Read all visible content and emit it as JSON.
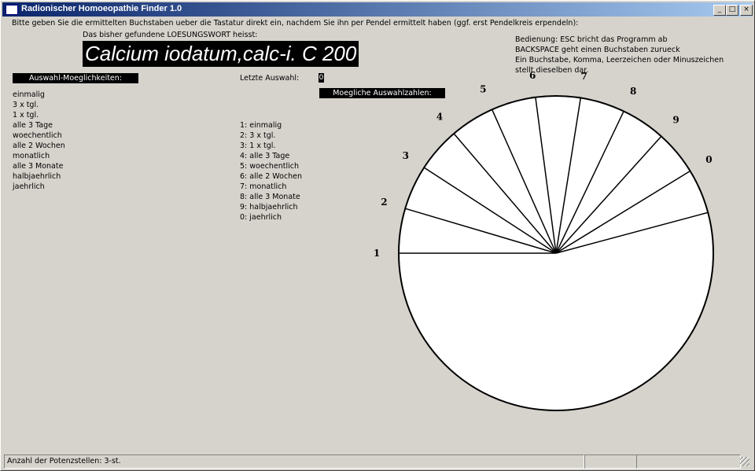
{
  "window": {
    "title": "Radionischer Homoeopathie Finder 1.0"
  },
  "titlebar_buttons": {
    "minimize": "_",
    "maximize": "□",
    "close": "×"
  },
  "instruction": "Bitte geben Sie die ermittelten Buchstaben ueber die Tastatur direkt ein, nachdem Sie ihn per Pendel ermittelt haben (ggf. erst Pendelkreis erpendeln):",
  "found_word_label": "Das bisher gefundene LOESUNGSWORT heisst:",
  "found_word": "Calcium iodatum,calc-i. C  200",
  "help": {
    "line1": "Bedienung: ESC bricht das Programm ab",
    "line2": "BACKSPACE geht einen Buchstaben zurueck",
    "line3": "Ein Buchstabe, Komma, Leerzeichen oder Minuszeichen",
    "line4": "stellt dieselben dar."
  },
  "options_header": "Auswahl-Moeglichkeiten:",
  "options": [
    "einmalig",
    "3 x tgl.",
    "1 x tgl.",
    "alle 3 Tage",
    "woechentlich",
    "alle 2 Wochen",
    "monatlich",
    "alle 3 Monate",
    "halbjaehrlich",
    "jaehrlich"
  ],
  "last_selection_label": "Letzte Auswahl:",
  "last_selection_value": "0",
  "numbers_header": "Moegliche Auswahlzahlen:",
  "numbered_options": [
    "1: einmalig",
    "2: 3 x tgl.",
    "3: 1 x tgl.",
    "4: alle 3 Tage",
    "5: woechentlich",
    "6: alle 2 Wochen",
    "7: monatlich",
    "8: alle 3 Monate",
    "9: halbjaehrlich",
    "0: jaehrlich"
  ],
  "pendulum": {
    "labels": [
      "1",
      "2",
      "3",
      "4",
      "5",
      "6",
      "7",
      "8",
      "9",
      "0"
    ],
    "fill": "#ffffff",
    "stroke": "#000000"
  },
  "status": {
    "potencies": "Anzahl der Potenzstellen: 3-st.",
    "cell2": "",
    "cell3": ""
  }
}
